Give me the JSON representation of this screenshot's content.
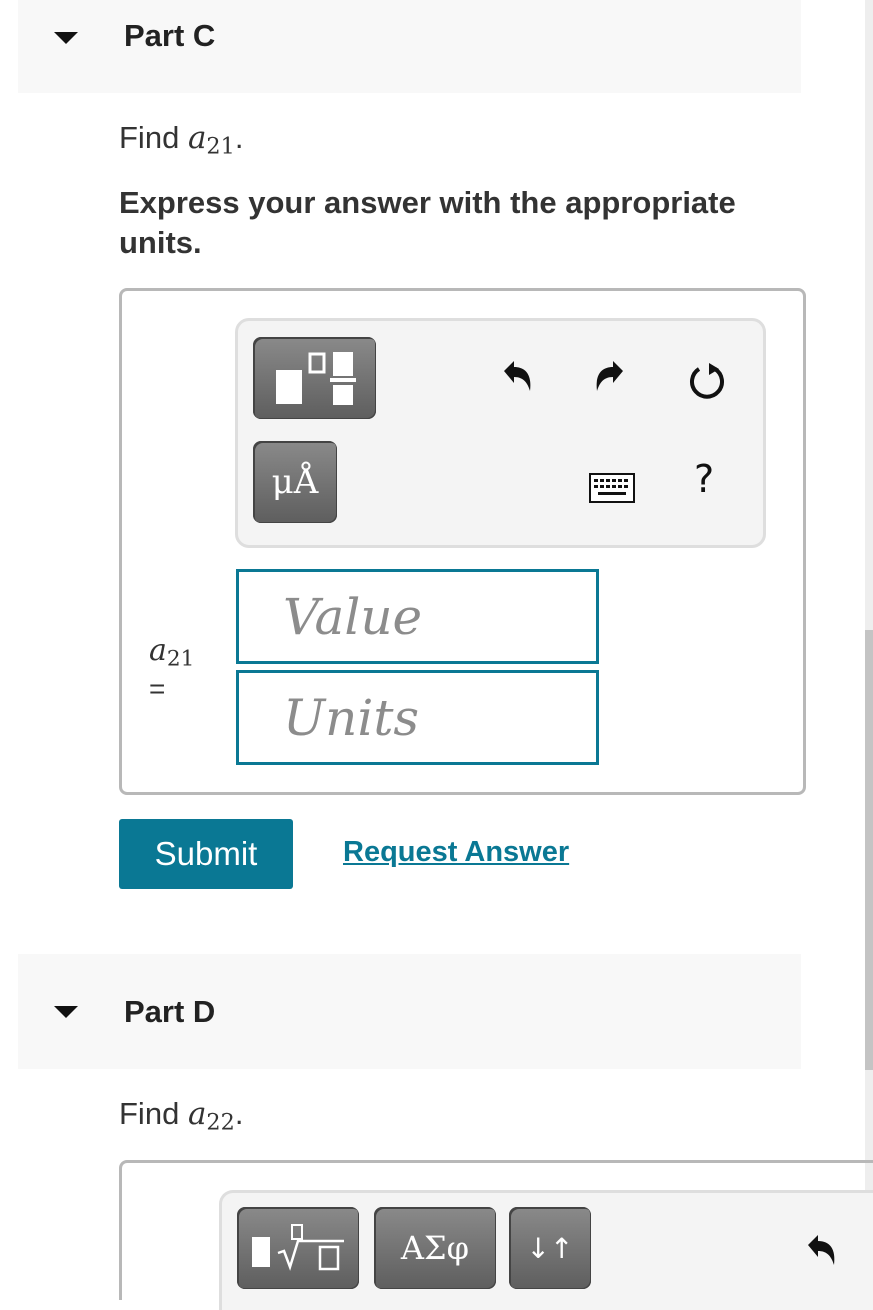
{
  "partC": {
    "title": "Part C",
    "find_text": "Find",
    "variable": "a",
    "subscript": "21",
    "instruction": "Express your answer with the appropriate units.",
    "toolbar": {
      "units_button_label": "μÅ",
      "help_label": "?",
      "icons": [
        "templates-icon",
        "units-icon",
        "undo-icon",
        "redo-icon",
        "reset-icon",
        "keyboard-icon",
        "help-icon"
      ]
    },
    "answer_label_var": "a",
    "answer_label_sub": "21",
    "answer_label_eq": "=",
    "value_placeholder": "Value",
    "units_placeholder": "Units",
    "submit_label": "Submit",
    "request_answer_label": "Request Answer"
  },
  "partD": {
    "title": "Part D",
    "find_text": "Find",
    "variable": "a",
    "subscript": "22",
    "toolbar": {
      "greek_label": "ΑΣφ",
      "arrows_label": "↓↑",
      "icons": [
        "templates-icon",
        "greek-icon",
        "arrows-icon",
        "undo-icon"
      ]
    }
  },
  "colors": {
    "accent": "#0a7894",
    "header_bg": "#f8f8f8",
    "button_gray": "#6e6e6e"
  }
}
